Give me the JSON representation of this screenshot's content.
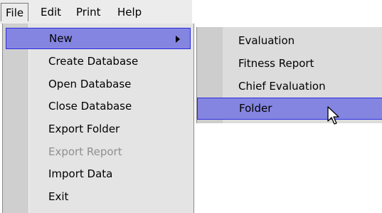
{
  "menubar": {
    "items": [
      {
        "label": "File",
        "active": true
      },
      {
        "label": "Edit"
      },
      {
        "label": "Print"
      },
      {
        "label": "Help"
      }
    ]
  },
  "file_menu": {
    "items": [
      {
        "label": "New",
        "highlighted": true,
        "has_submenu": true
      },
      {
        "label": "Create Database"
      },
      {
        "label": "Open Database"
      },
      {
        "label": "Close Database"
      },
      {
        "label": "Export Folder"
      },
      {
        "label": "Export Report",
        "disabled": true
      },
      {
        "label": "Import Data"
      },
      {
        "label": "Exit"
      }
    ]
  },
  "new_submenu": {
    "items": [
      {
        "label": "Evaluation"
      },
      {
        "label": "Fitness Report"
      },
      {
        "label": "Chief Evaluation"
      },
      {
        "label": "Folder",
        "highlighted": true
      }
    ]
  },
  "colors": {
    "highlight": "#8485e0",
    "highlight_border": "#2c2ce0",
    "menu_bg": "#e4e4e4",
    "disabled_text": "#8f8f8f"
  },
  "icons": {
    "submenu_arrow": "triangle-right-icon",
    "pointer": "mouse-pointer-icon"
  }
}
